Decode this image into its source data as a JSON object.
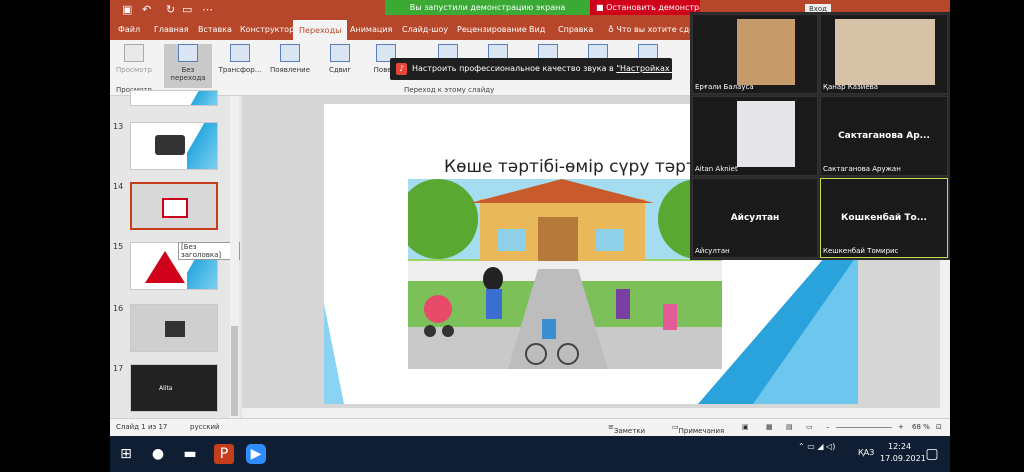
{
  "titlebar": {
    "demo_started": "Вы запустили демонстрацию экрана",
    "stop_demo": "Остановить демонстрацию",
    "signin": "Вход"
  },
  "menu": {
    "items": [
      "Файл",
      "Главная",
      "Вставка",
      "Конструктор",
      "Переходы",
      "Анимация",
      "Слайд-шоу",
      "Рецензирование",
      "Вид",
      "Справка"
    ],
    "active": "Переходы",
    "tell_me": "Что вы хотите сдела"
  },
  "ribbon": {
    "buttons": [
      "Просмотр",
      "Без перехода",
      "Трансфор...",
      "Появление",
      "Сдвиг",
      "Пове..."
    ],
    "group_preview": "Просмотр",
    "group_transition": "Переход к этому слайду"
  },
  "toast": {
    "text_prefix": "Настроить профессиональное качество звука в",
    "link": "\"Настройках звука\""
  },
  "slides": {
    "numbers": [
      "13",
      "14",
      "15",
      "16",
      "17"
    ],
    "tooltip": "[Без заголовка]",
    "thumb17_label": "Alita"
  },
  "slide": {
    "title": "Көше тәртібі-өмір сүру тәртібі"
  },
  "status": {
    "slide_count": "Слайд 1 из 17",
    "language": "русский",
    "notes": "Заметки",
    "comments": "Примечания",
    "zoom": "68 %"
  },
  "participants": [
    {
      "name": "Ерғали Балауса",
      "center": ""
    },
    {
      "name": "Қанар Казиева",
      "center": ""
    },
    {
      "name": "Aitan Akniet",
      "center": ""
    },
    {
      "name": "Сактаганова Аружан",
      "center": "Сактаганова  Ар..."
    },
    {
      "name": "Айсултан",
      "center": "Айсултан"
    },
    {
      "name": "Кешкенбай Томирис",
      "center": "Кошкенбай  То..."
    }
  ],
  "tray": {
    "lang": "ҚАЗ",
    "time": "12:24",
    "date": "17.09.2021"
  },
  "colors": {
    "ppt_red": "#b7472a",
    "accent_blue": "#2aa2dc",
    "zoom_bg": "#2b2b2b",
    "taskbar": "#0f1e33"
  }
}
